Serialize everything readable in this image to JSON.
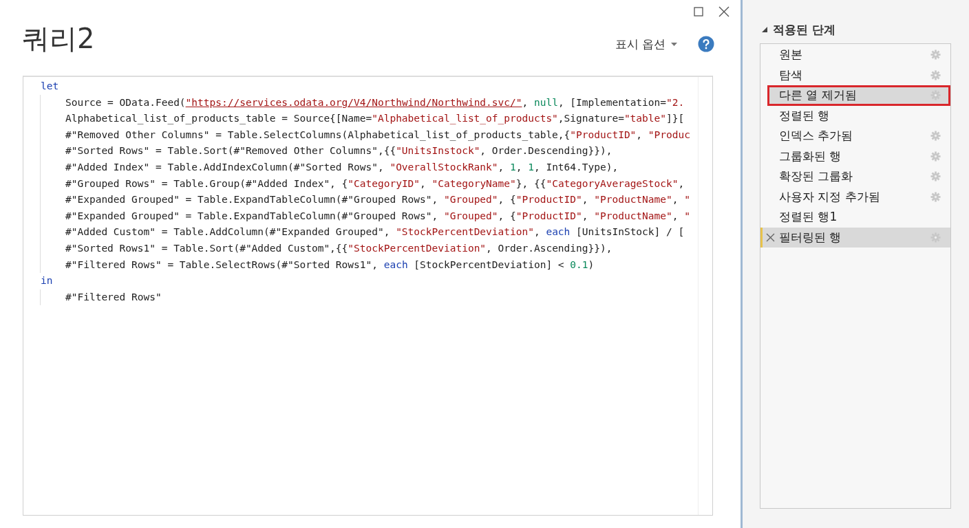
{
  "window": {
    "title": "쿼리2"
  },
  "toolbar": {
    "display_options": "표시 옵션"
  },
  "editor": {
    "lines": [
      {
        "indent": false,
        "tokens": [
          {
            "kind": "keyword",
            "text": "let"
          }
        ]
      },
      {
        "indent": true,
        "tokens": [
          {
            "kind": "plain",
            "text": "Source = OData.Feed("
          },
          {
            "kind": "url",
            "text": "\"https://services.odata.org/V4/Northwind/Northwind.svc/\""
          },
          {
            "kind": "plain",
            "text": ", "
          },
          {
            "kind": "number",
            "text": "null"
          },
          {
            "kind": "plain",
            "text": ", [Implementation="
          },
          {
            "kind": "string",
            "text": "\"2."
          }
        ]
      },
      {
        "indent": true,
        "tokens": [
          {
            "kind": "plain",
            "text": "Alphabetical_list_of_products_table = Source{[Name="
          },
          {
            "kind": "string",
            "text": "\"Alphabetical_list_of_products\""
          },
          {
            "kind": "plain",
            "text": ",Signature="
          },
          {
            "kind": "string",
            "text": "\"table\""
          },
          {
            "kind": "plain",
            "text": "]}["
          }
        ]
      },
      {
        "indent": true,
        "tokens": [
          {
            "kind": "plain",
            "text": "#\"Removed Other Columns\" = Table.SelectColumns(Alphabetical_list_of_products_table,{"
          },
          {
            "kind": "string",
            "text": "\"ProductID\""
          },
          {
            "kind": "plain",
            "text": ", "
          },
          {
            "kind": "string",
            "text": "\"Produc"
          }
        ]
      },
      {
        "indent": true,
        "tokens": [
          {
            "kind": "plain",
            "text": "#\"Sorted Rows\" = Table.Sort(#\"Removed Other Columns\",{{"
          },
          {
            "kind": "string",
            "text": "\"UnitsInstock\""
          },
          {
            "kind": "plain",
            "text": ", Order.Descending}}),"
          }
        ]
      },
      {
        "indent": true,
        "tokens": [
          {
            "kind": "plain",
            "text": "#\"Added Index\" = Table.AddIndexColumn(#\"Sorted Rows\", "
          },
          {
            "kind": "string",
            "text": "\"OverallStockRank\""
          },
          {
            "kind": "plain",
            "text": ", "
          },
          {
            "kind": "number",
            "text": "1"
          },
          {
            "kind": "plain",
            "text": ", "
          },
          {
            "kind": "number",
            "text": "1"
          },
          {
            "kind": "plain",
            "text": ", Int64.Type),"
          }
        ]
      },
      {
        "indent": true,
        "tokens": [
          {
            "kind": "plain",
            "text": "#\"Grouped Rows\" = Table.Group(#\"Added Index\", {"
          },
          {
            "kind": "string",
            "text": "\"CategoryID\""
          },
          {
            "kind": "plain",
            "text": ", "
          },
          {
            "kind": "string",
            "text": "\"CategoryName\""
          },
          {
            "kind": "plain",
            "text": "}, {{"
          },
          {
            "kind": "string",
            "text": "\"CategoryAverageStock\""
          },
          {
            "kind": "plain",
            "text": ","
          }
        ]
      },
      {
        "indent": true,
        "tokens": [
          {
            "kind": "plain",
            "text": "#\"Expanded Grouped\" = Table.ExpandTableColumn(#\"Grouped Rows\", "
          },
          {
            "kind": "string",
            "text": "\"Grouped\""
          },
          {
            "kind": "plain",
            "text": ", {"
          },
          {
            "kind": "string",
            "text": "\"ProductID\""
          },
          {
            "kind": "plain",
            "text": ", "
          },
          {
            "kind": "string",
            "text": "\"ProductName\""
          },
          {
            "kind": "plain",
            "text": ", "
          },
          {
            "kind": "string",
            "text": "\""
          }
        ]
      },
      {
        "indent": true,
        "tokens": [
          {
            "kind": "plain",
            "text": "#\"Expanded Grouped\" = Table.ExpandTableColumn(#\"Grouped Rows\", "
          },
          {
            "kind": "string",
            "text": "\"Grouped\""
          },
          {
            "kind": "plain",
            "text": ", {"
          },
          {
            "kind": "string",
            "text": "\"ProductID\""
          },
          {
            "kind": "plain",
            "text": ", "
          },
          {
            "kind": "string",
            "text": "\"ProductName\""
          },
          {
            "kind": "plain",
            "text": ", "
          },
          {
            "kind": "string",
            "text": "\""
          }
        ]
      },
      {
        "indent": true,
        "tokens": [
          {
            "kind": "plain",
            "text": "#\"Added Custom\" = Table.AddColumn(#\"Expanded Grouped\", "
          },
          {
            "kind": "string",
            "text": "\"StockPercentDeviation\""
          },
          {
            "kind": "plain",
            "text": ", "
          },
          {
            "kind": "keyword",
            "text": "each"
          },
          {
            "kind": "plain",
            "text": " [UnitsInStock] / ["
          }
        ]
      },
      {
        "indent": true,
        "tokens": [
          {
            "kind": "plain",
            "text": "#\"Sorted Rows1\" = Table.Sort(#\"Added Custom\",{{"
          },
          {
            "kind": "string",
            "text": "\"StockPercentDeviation\""
          },
          {
            "kind": "plain",
            "text": ", Order.Ascending}}),"
          }
        ]
      },
      {
        "indent": true,
        "tokens": [
          {
            "kind": "plain",
            "text": "#\"Filtered Rows\" = Table.SelectRows(#\"Sorted Rows1\", "
          },
          {
            "kind": "keyword",
            "text": "each"
          },
          {
            "kind": "plain",
            "text": " [StockPercentDeviation] < "
          },
          {
            "kind": "number",
            "text": "0.1"
          },
          {
            "kind": "plain",
            "text": ")"
          }
        ]
      },
      {
        "indent": false,
        "tokens": [
          {
            "kind": "keyword",
            "text": "in"
          }
        ]
      },
      {
        "indent": true,
        "tokens": [
          {
            "kind": "plain",
            "text": "#\"Filtered Rows\""
          }
        ]
      }
    ]
  },
  "applied_steps": {
    "title": "적용된 단계",
    "expanded": true,
    "steps": [
      {
        "name": "원본",
        "selected": false,
        "outlined": false,
        "settings": true,
        "delete": false
      },
      {
        "name": "탐색",
        "selected": false,
        "outlined": false,
        "settings": true,
        "delete": false
      },
      {
        "name": "다른 열 제거됨",
        "selected": true,
        "outlined": true,
        "settings": true,
        "delete": false
      },
      {
        "name": "정렬된 행",
        "selected": false,
        "outlined": false,
        "settings": false,
        "delete": false
      },
      {
        "name": "인덱스 추가됨",
        "selected": false,
        "outlined": false,
        "settings": true,
        "delete": false
      },
      {
        "name": "그룹화된 행",
        "selected": false,
        "outlined": false,
        "settings": true,
        "delete": false
      },
      {
        "name": "확장된 그룹화",
        "selected": false,
        "outlined": false,
        "settings": true,
        "delete": false
      },
      {
        "name": "사용자 지정 추가됨",
        "selected": false,
        "outlined": false,
        "settings": true,
        "delete": false
      },
      {
        "name": "정렬된 행1",
        "selected": false,
        "outlined": false,
        "settings": false,
        "delete": false
      },
      {
        "name": "필터링된 행",
        "selected": true,
        "outlined": false,
        "settings": true,
        "delete": true
      }
    ]
  }
}
